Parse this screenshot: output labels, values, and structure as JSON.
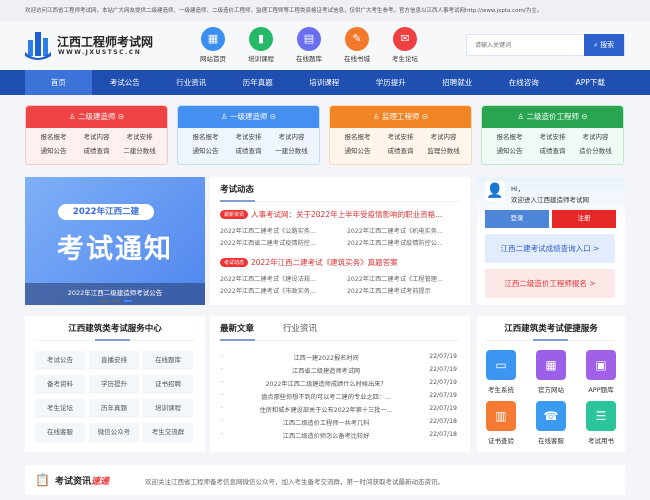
{
  "topbar": {
    "notice": "欢迎访问江西省工程师考试网，本站广大网友提供二级建造师、一级建造师、二级造价工程师，监理工程师等工程类资格证考试信息，仅供广大考生参考。官方信息以江西人事考试网http://www.jxpta.com/为主。"
  },
  "logo": {
    "title": "江西工程师考试网",
    "url": "WWW.JXUSTSC.CN"
  },
  "quick_links": [
    {
      "label": "网站首页",
      "icon": "calendar-icon",
      "color": "#3a8ff0",
      "glyph": "▦"
    },
    {
      "label": "培训课程",
      "icon": "chart-icon",
      "color": "#25b866",
      "glyph": "▮"
    },
    {
      "label": "在线题库",
      "icon": "document-icon",
      "color": "#6a6ff0",
      "glyph": "▤"
    },
    {
      "label": "在线书城",
      "icon": "book-icon",
      "color": "#f37a2a",
      "glyph": "✎"
    },
    {
      "label": "考生论坛",
      "icon": "chat-icon",
      "color": "#ee4040",
      "glyph": "✉"
    }
  ],
  "search": {
    "placeholder": "请输入关键词",
    "button": "搜索"
  },
  "nav": [
    "首页",
    "考试公告",
    "行业资讯",
    "历年真题",
    "培训课程",
    "学历提升",
    "招聘就业",
    "在线咨询",
    "APP下载"
  ],
  "cards": [
    {
      "title": "二级建造师",
      "color": "#ee4444",
      "bg": "#fff0f0",
      "border": "#f8c9c9",
      "items": [
        "报名报考",
        "考试内容",
        "考试安排",
        "通知公告",
        "成绩查询",
        "二建分数线"
      ]
    },
    {
      "title": "一级建造师",
      "color": "#4390f0",
      "bg": "#eef5ff",
      "border": "#c4dcf8",
      "items": [
        "报名报考",
        "考试安排",
        "考试内容",
        "通知公告",
        "成绩查询",
        "一建分数线"
      ]
    },
    {
      "title": "监理工程师",
      "color": "#f18424",
      "bg": "#fff5ea",
      "border": "#f8d9b8",
      "items": [
        "报名报考",
        "考试安排",
        "考试内容",
        "通知公告",
        "成绩查询",
        "监理分数线"
      ]
    },
    {
      "title": "二级造价工程师",
      "color": "#2aa653",
      "bg": "#eefaf3",
      "border": "#bfe8cc",
      "items": [
        "报名报考",
        "考试安排",
        "考试内容",
        "通知公告",
        "成绩查询",
        "造价分数线"
      ]
    }
  ],
  "banner": {
    "pill": "2022年江西二建",
    "headline": "考试通知",
    "caption": "2022年江西二级建造师考试公告"
  },
  "news": {
    "title": "考试动态",
    "blocks": [
      {
        "tag": "最新资讯",
        "headline": "人事考试网：关于2022年上半年受疫情影响的职业资格...",
        "items": [
          "2022年江西二建考试《公路实务...",
          "2022年江西二建考试《机电实务...",
          "2022年江西省二建考试疫情防控...",
          "2022年江西二建考试疫情防控公..."
        ]
      },
      {
        "tag": "考试动态",
        "headline": "2022年江西二建考试《建筑实务》真题答案",
        "items": [
          "2022年江西二建考试《建设法规...",
          "2022年江西二建考试《工程管理...",
          "2022年江西二建考试《市政实务...",
          "2022年江西二建考试考前提示"
        ]
      }
    ]
  },
  "user": {
    "greeting": "Hi，",
    "welcome": "欢迎进入江西建造师考试网",
    "login": "登录",
    "register": "注册",
    "link1": "江西二建考试成绩查询入口 >",
    "link2": "江西二级造价工程师报名 >"
  },
  "service": {
    "title": "江西建筑类考试服务中心",
    "items": [
      "考试公告",
      "直播安排",
      "在线题库",
      "备考资料",
      "学历提升",
      "证书招聘",
      "考生论坛",
      "历年真题",
      "培训课程",
      "在线客服",
      "微信公众号",
      "考生交流群"
    ]
  },
  "articles": {
    "tabs": [
      "最新文章",
      "行业资讯"
    ],
    "items": [
      {
        "title": "江西一建2022报名时间",
        "date": "22/07/19"
      },
      {
        "title": "江西省二级建造师考试网",
        "date": "22/07/19"
      },
      {
        "title": "2022年江西二级建造师成绩什么时候出来？",
        "date": "22/07/19"
      },
      {
        "title": "盘点那些你想不到的可以考二建的专业之四：...",
        "date": "22/07/19"
      },
      {
        "title": "住房和城乡建设部关于公布2022年第十三批一...",
        "date": "22/07/19"
      },
      {
        "title": "江西二级造价工程师一共考几科",
        "date": "22/07/18"
      },
      {
        "title": "江西二级造价师怎么备考比较好",
        "date": "22/07/18"
      }
    ]
  },
  "convenience": {
    "title": "江西建筑类考试便捷服务",
    "items": [
      {
        "label": "考生系统",
        "icon": "message-icon",
        "color": "#3b96f2",
        "glyph": "▭"
      },
      {
        "label": "官方网站",
        "icon": "calendar-icon",
        "color": "#9b5fe8",
        "glyph": "▦"
      },
      {
        "label": "APP题库",
        "icon": "app-icon",
        "color": "#a060e8",
        "glyph": "▣"
      },
      {
        "label": "证书查验",
        "icon": "presentation-icon",
        "color": "#f57b35",
        "glyph": "▥"
      },
      {
        "label": "在线客服",
        "icon": "phone-icon",
        "color": "#3b9af2",
        "glyph": "☎"
      },
      {
        "label": "考试用书",
        "icon": "book-icon",
        "color": "#2cc49a",
        "glyph": "☰"
      }
    ]
  },
  "footer": {
    "title_a": "考试资讯",
    "title_b": "速递",
    "text": "欢迎关注江西省工程师备考信息网微信公众号，加入考生备考交流群，第一时间获取考试最新动态资讯。"
  }
}
